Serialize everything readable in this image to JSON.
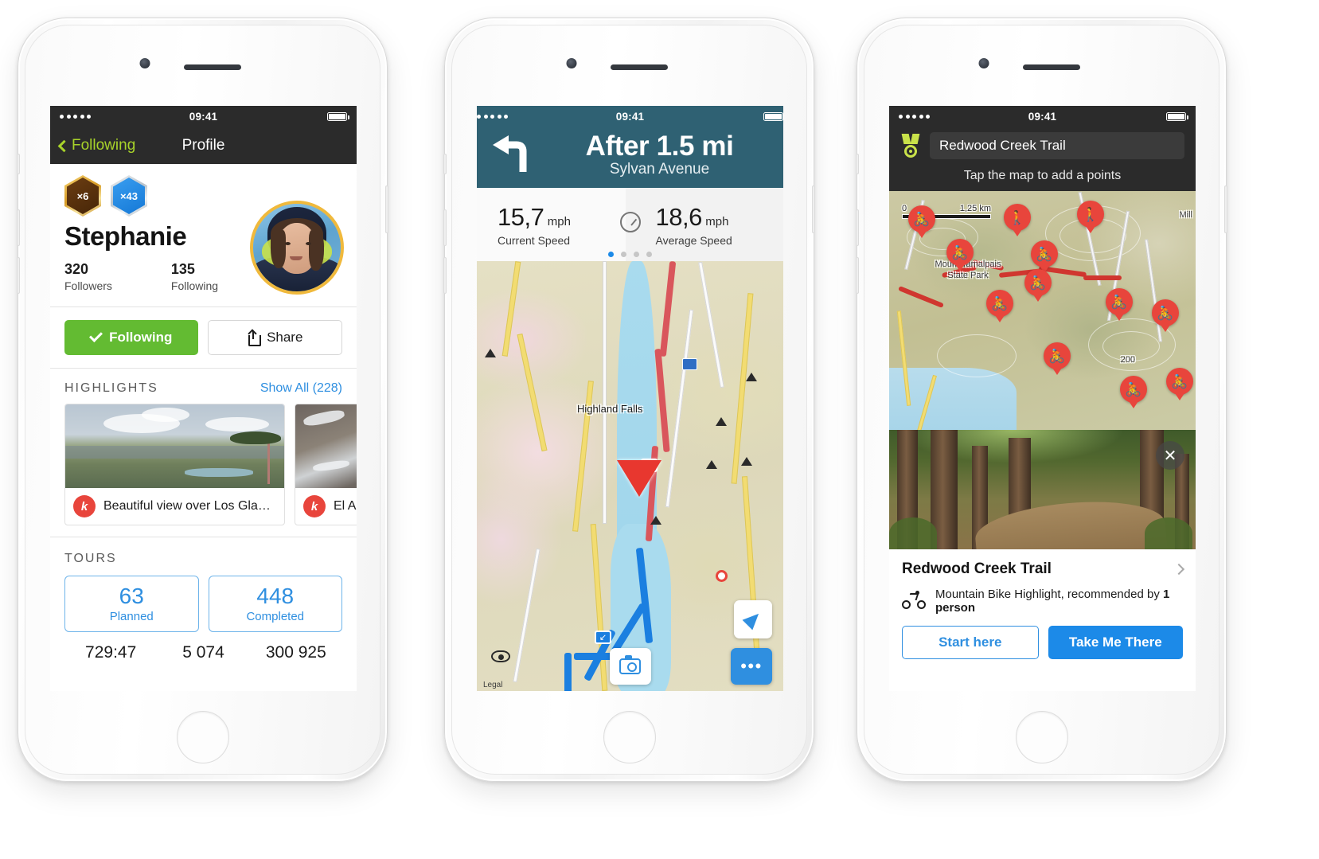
{
  "phones": [
    {
      "id": "profile",
      "status": {
        "time": "09:41",
        "signal_dots": 5
      },
      "nav": {
        "back_label": "Following",
        "title": "Profile"
      },
      "badges": [
        {
          "name": "gold-hex-badge",
          "count": "×6"
        },
        {
          "name": "silver-hex-badge",
          "count": "×43"
        }
      ],
      "user": {
        "name": "Stephanie",
        "followers_count": "320",
        "followers_label": "Followers",
        "following_count": "135",
        "following_label": "Following"
      },
      "actions": {
        "follow_label": "Following",
        "share_label": "Share"
      },
      "highlights": {
        "section_title": "HIGHLIGHTS",
        "show_all_label": "Show All (228)",
        "items": [
          {
            "title": "Beautiful view over Los Glac…",
            "badge": "hiking-badge"
          },
          {
            "title": "El Abuel",
            "badge": "hiking-badge"
          }
        ]
      },
      "tours": {
        "section_title": "TOURS",
        "boxes": [
          {
            "value": "63",
            "label": "Planned"
          },
          {
            "value": "448",
            "label": "Completed"
          }
        ],
        "stats": [
          "729:47",
          "5 074",
          "300 925"
        ]
      }
    },
    {
      "id": "navigation",
      "status": {
        "time": "09:41",
        "signal_dots": 5
      },
      "turn": {
        "distance": "After 1.5 mi",
        "street": "Sylvan Avenue",
        "maneuver": "turn-left"
      },
      "speeds": [
        {
          "value": "15,7",
          "unit": "mph",
          "label": "Current Speed"
        },
        {
          "value": "18,6",
          "unit": "mph",
          "label": "Average Speed"
        }
      ],
      "page_dots": {
        "total": 4,
        "active": 0
      },
      "map": {
        "labels": [
          "Highland Falls"
        ],
        "legal_label": "Legal",
        "controls": [
          {
            "name": "locate-button"
          },
          {
            "name": "camera-button"
          },
          {
            "name": "more-options-button",
            "label": "•••"
          }
        ]
      }
    },
    {
      "id": "planner",
      "status": {
        "time": "09:41",
        "signal_dots": 5
      },
      "header": {
        "icon": "medal-icon",
        "search_value": "Redwood Creek Trail",
        "hint": "Tap the map to add a points"
      },
      "map": {
        "scale": {
          "min": "0",
          "max": "1,25 km"
        },
        "labels": [
          "Mount Tamalpais",
          "State Park",
          "Mill",
          "200"
        ],
        "pins": [
          "mountain-bike-pin",
          "hiking-pin",
          "hiking-pin",
          "mountain-bike-pin",
          "mountain-bike-pin",
          "mountain-bike-pin",
          "mountain-bike-pin",
          "mountain-bike-pin",
          "mountain-bike-pin",
          "mountain-bike-pin",
          "mountain-bike-pin"
        ]
      },
      "photo": {
        "close_label": "✕"
      },
      "card": {
        "title": "Redwood Creek Trail",
        "meta_prefix": "Mountain Bike Highlight, recommended by ",
        "meta_bold": "1 person",
        "buttons": [
          {
            "label": "Start here",
            "style": "outline"
          },
          {
            "label": "Take Me There",
            "style": "filled"
          }
        ]
      }
    }
  ],
  "colors": {
    "accent_green": "#a8d32a",
    "follow_green": "#63bb32",
    "link_blue": "#2f8fe0",
    "nav_teal": "#2f6173",
    "dark_bar": "#2b2b2b",
    "pin_red": "#e8453c",
    "avatar_ring": "#f0b93c"
  }
}
